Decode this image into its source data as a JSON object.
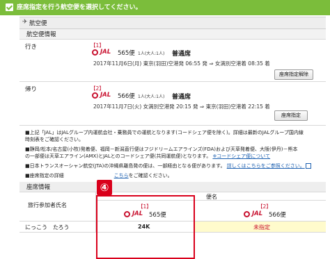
{
  "banner": {
    "text": "座席指定を行う航空便を選択してください。"
  },
  "section": {
    "title": "航空便",
    "info_title": "航空便情報",
    "seat_title": "座席情報"
  },
  "segments": [
    {
      "label": "行き",
      "seg_no": "【1】",
      "airline": "JAL",
      "flight": "565便",
      "pax": "1人(大人:1人)",
      "fare": "普通席",
      "schedule": "2017年11月6日(月) 東京(羽田)空港発 06:55 発 ⇒ 女満別空港着 08:35 着",
      "button": "座席指定解除"
    },
    {
      "label": "帰り",
      "seg_no": "【2】",
      "airline": "JAL",
      "flight": "566便",
      "pax": "1人(大人:1人)",
      "fare": "普通席",
      "schedule": "2017年11月7日(火) 女満別空港発 20:15 発 ⇒ 東京(羽田)空港着 22:15 着",
      "button": "座席指定"
    }
  ],
  "notes": {
    "n1": "■上記「JAL」はJALグループ内運航会社・乗務員での運航となります(コードシェア便を除く)。詳細は最新のJALグループ国内線",
    "n1b": "時刻表をご確認ください。",
    "n2": "■静岡/松本/名古屋(小牧)発着便、福岡－新潟直行便はフジドリームエアラインズ(FDA)および天草発着便、大阪(伊丹)－熊本",
    "n2b": "の一部便は天草エアライン(AMX)とJALとのコードシェア便(共同運航便)となります。",
    "n2_link": "※コードシェア便について",
    "n3": "■日本トランスオーシャン航空(JTA)の沖縄県離島発の便は、一部経由となる便があります。",
    "n3_link": "詳しくはこちらをご参照ください。",
    "n4": "■座席指定の詳細",
    "n4_link": "こちら",
    "n4b": "をご確認ください。"
  },
  "seat_table": {
    "col_passenger": "旅行参加者氏名",
    "col_flight": "便名",
    "flights": [
      {
        "seg_no": "【1】",
        "airline": "JAL",
        "flight": "565便"
      },
      {
        "seg_no": "【2】",
        "airline": "JAL",
        "flight": "566便"
      }
    ],
    "rows": [
      {
        "name": "にっこう　たろう",
        "seat1": "24K",
        "seat2": "未指定"
      }
    ]
  },
  "callout": {
    "label": "④"
  },
  "colors": {
    "banner": "#7bbd3b",
    "jal_red": "#c8102e",
    "highlight": "#d9001b",
    "unassigned_bg": "#fffbcc"
  }
}
